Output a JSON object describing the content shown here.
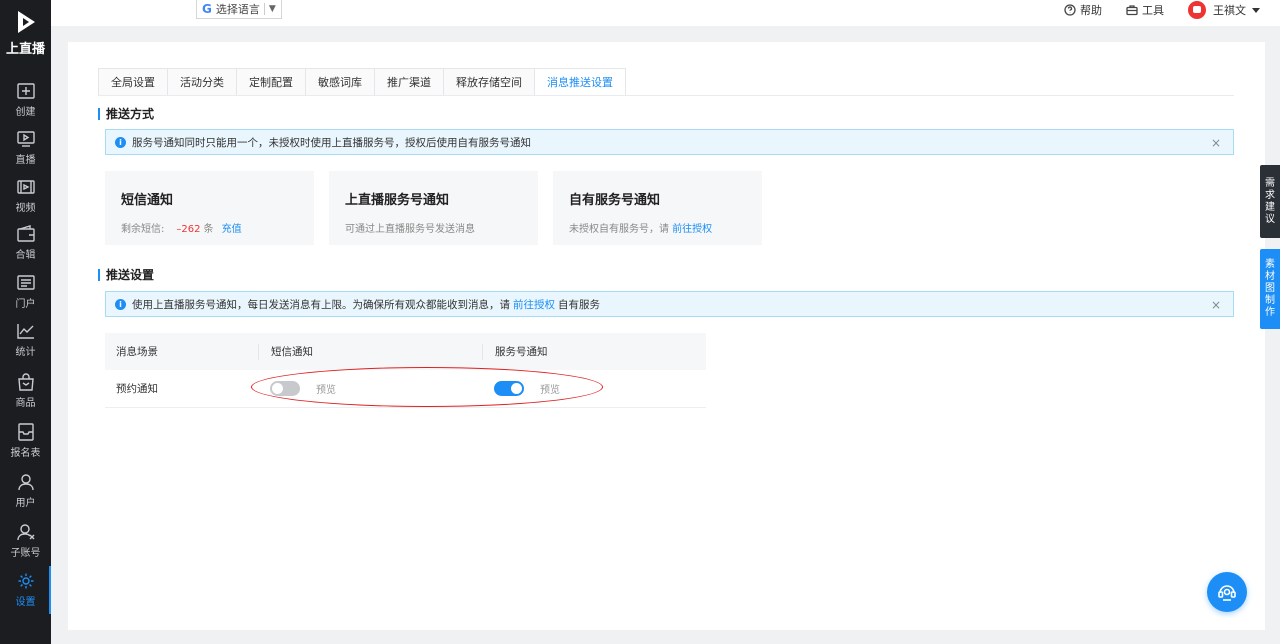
{
  "brand": {
    "name": "上直播"
  },
  "sidebar": {
    "items": [
      {
        "label": "创建",
        "icon": "plus-square-icon"
      },
      {
        "label": "直播",
        "icon": "play-screen-icon"
      },
      {
        "label": "视频",
        "icon": "film-icon"
      },
      {
        "label": "合辑",
        "icon": "wallet-icon"
      },
      {
        "label": "门户",
        "icon": "portal-icon"
      },
      {
        "label": "统计",
        "icon": "line-chart-icon"
      },
      {
        "label": "商品",
        "icon": "bag-icon"
      },
      {
        "label": "报名表",
        "icon": "form-icon"
      },
      {
        "label": "用户",
        "icon": "user-icon"
      },
      {
        "label": "子账号",
        "icon": "sub-account-icon"
      },
      {
        "label": "设置",
        "icon": "gear-icon",
        "active": true
      }
    ]
  },
  "topbar": {
    "lang_logo": "G",
    "lang_label": "选择语言",
    "lang_caret": "▼",
    "help": "帮助",
    "tools": "工具",
    "username": "王祺文"
  },
  "tabs": [
    {
      "label": "全局设置"
    },
    {
      "label": "活动分类"
    },
    {
      "label": "定制配置"
    },
    {
      "label": "敏感词库"
    },
    {
      "label": "推广渠道"
    },
    {
      "label": "释放存储空间"
    },
    {
      "label": "消息推送设置",
      "active": true
    }
  ],
  "push_method": {
    "title": "推送方式",
    "alert": "服务号通知同时只能用一个，未授权时使用上直播服务号，授权后使用自有服务号通知",
    "cards": [
      {
        "title": "短信通知",
        "desc_prefix": "剩余短信:",
        "count": "–262",
        "unit": "条",
        "link": "充值"
      },
      {
        "title": "上直播服务号通知",
        "desc": "可通过上直播服务号发送消息"
      },
      {
        "title": "自有服务号通知",
        "desc": "未授权自有服务号，请",
        "link": "前往授权"
      }
    ]
  },
  "push_settings": {
    "title": "推送设置",
    "alert_prefix": "使用上直播服务号通知，每日发送消息有上限。为确保所有观众都能收到消息，请",
    "alert_link": "前往授权",
    "alert_suffix": "自有服务",
    "table": {
      "headers": [
        "消息场景",
        "短信通知",
        "服务号通知"
      ],
      "rows": [
        {
          "scene": "预约通知",
          "sms_on": false,
          "sms_preview": "预览",
          "service_on": true,
          "service_preview": "预览"
        }
      ]
    }
  },
  "float_tabs": [
    {
      "label": "需求建议",
      "color": "#2b2f36"
    },
    {
      "label": "素材图制作",
      "color": "#1c8ef5"
    }
  ],
  "close_symbol": "×",
  "alert_icon_symbol": "i"
}
